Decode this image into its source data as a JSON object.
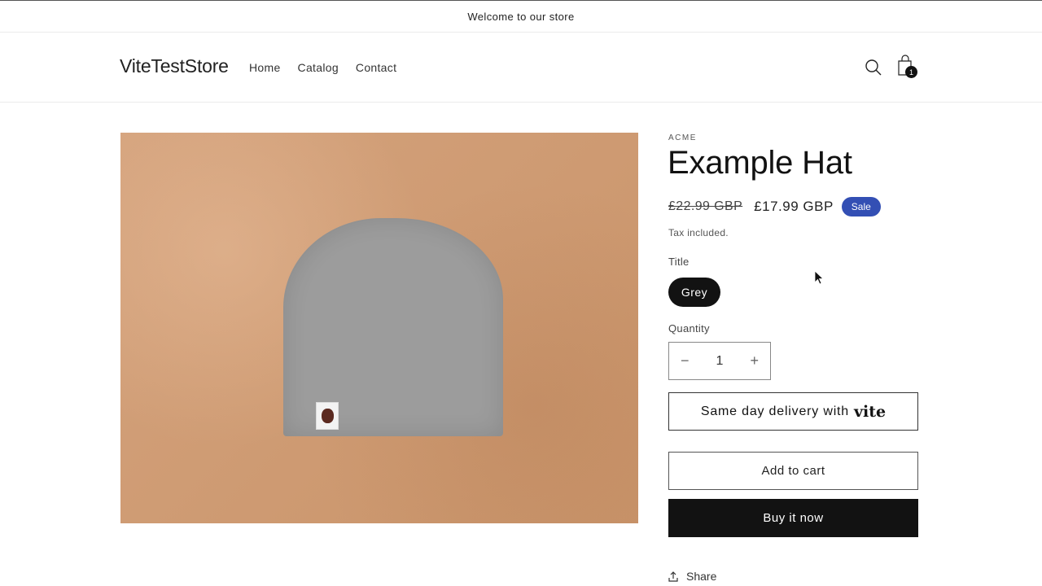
{
  "announcement": {
    "text": "Welcome to our store"
  },
  "header": {
    "logo": "ViteTestStore",
    "nav": [
      {
        "label": "Home"
      },
      {
        "label": "Catalog"
      },
      {
        "label": "Contact"
      }
    ],
    "icons": {
      "search": "search-icon",
      "cart": "cart-icon"
    },
    "cart_count": "1"
  },
  "product": {
    "image_alt": "Grey beanie hat on cardboard",
    "vendor": "ACME",
    "title": "Example Hat",
    "price_compare": "£22.99 GBP",
    "price": "£17.99 GBP",
    "sale_badge": "Sale",
    "tax_note": "Tax included.",
    "option_label": "Title",
    "option_value": "Grey",
    "quantity_label": "Quantity",
    "quantity": "1",
    "quantity_decrease": "−",
    "quantity_increase": "+",
    "vite_button_text": "Same day delivery with",
    "vite_brand": "vite",
    "add_to_cart": "Add to cart",
    "buy_now": "Buy it now",
    "share": "Share"
  },
  "colors": {
    "sale_badge": "#334fb4",
    "primary_button": "#121212",
    "board": "#cf9c74"
  }
}
